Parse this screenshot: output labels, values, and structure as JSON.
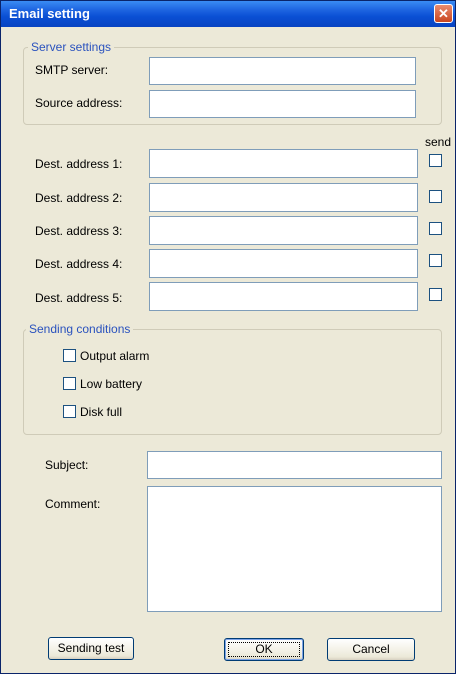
{
  "window": {
    "title": "Email setting",
    "close_glyph": "✕"
  },
  "server": {
    "legend": "Server settings",
    "smtp_label": "SMTP server:",
    "smtp_value": "",
    "source_label": "Source address:",
    "source_value": ""
  },
  "destinations": {
    "send_header": "send",
    "items": [
      {
        "label": "Dest. address 1:",
        "value": "",
        "send": false
      },
      {
        "label": "Dest. address 2:",
        "value": "",
        "send": false
      },
      {
        "label": "Dest. address 3:",
        "value": "",
        "send": false
      },
      {
        "label": "Dest. address 4:",
        "value": "",
        "send": false
      },
      {
        "label": "Dest. address 5:",
        "value": "",
        "send": false
      }
    ]
  },
  "conditions": {
    "legend": "Sending conditions",
    "items": [
      {
        "label": "Output alarm",
        "checked": false
      },
      {
        "label": "Low battery",
        "checked": false
      },
      {
        "label": "Disk full",
        "checked": false
      }
    ]
  },
  "message": {
    "subject_label": "Subject:",
    "subject_value": "",
    "comment_label": "Comment:",
    "comment_value": ""
  },
  "buttons": {
    "test": "Sending test",
    "ok": "OK",
    "cancel": "Cancel"
  }
}
